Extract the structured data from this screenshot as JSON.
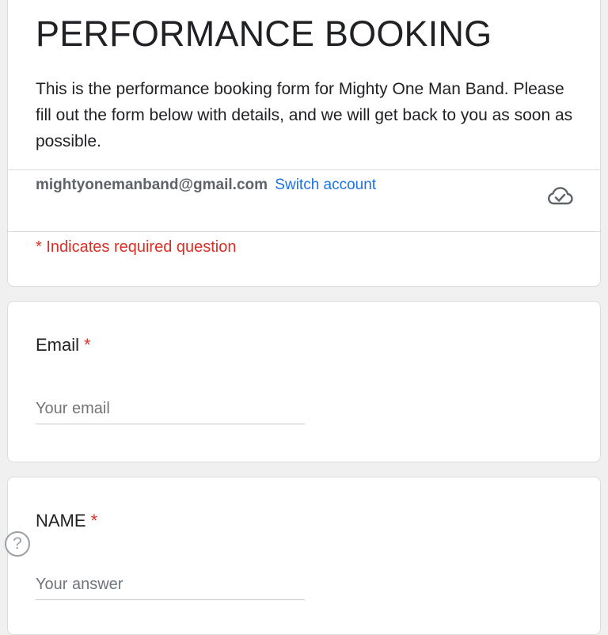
{
  "header": {
    "title": "PERFORMANCE BOOKING",
    "description": "This is the performance booking form for Mighty One Man Band. Please fill out the form below with details, and we will get back to you as soon as possible.",
    "account_email": "mightyonemanband@gmail.com",
    "switch_account": "Switch account",
    "cloud_icon": "cloud-saved-icon",
    "required_note": "* Indicates required question"
  },
  "questions": [
    {
      "label": "Email",
      "required_marker": "*",
      "placeholder": "Your email",
      "value": ""
    },
    {
      "label": "NAME",
      "required_marker": "*",
      "placeholder": "Your answer",
      "value": ""
    }
  ],
  "help": {
    "icon": "help-icon",
    "glyph": "?"
  },
  "colors": {
    "background": "#f0f0f0",
    "card": "#ffffff",
    "link": "#1a73e8",
    "required": "#d93025"
  }
}
